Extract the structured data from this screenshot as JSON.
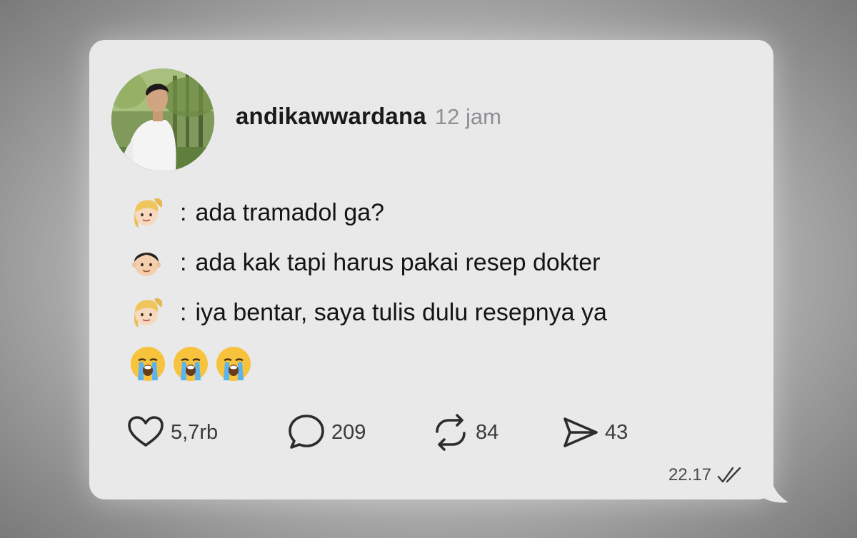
{
  "post": {
    "username": "andikawwardana",
    "time_ago": "12 jam",
    "avatar_icon": "profile-photo-man-white-shirt-garden"
  },
  "chat": [
    {
      "speaker_icon": "woman-blonde-ponytail-emoji",
      "separator": ":",
      "text": "ada tramadol ga?"
    },
    {
      "speaker_icon": "man-black-hair-emoji",
      "separator": ":",
      "text": "ada kak tapi harus pakai resep dokter"
    },
    {
      "speaker_icon": "woman-blonde-ponytail-emoji",
      "separator": ":",
      "text": "iya bentar, saya tulis dulu resepnya ya"
    }
  ],
  "reaction_emojis": [
    "loudly-crying-face-emoji",
    "loudly-crying-face-emoji",
    "loudly-crying-face-emoji"
  ],
  "actions": {
    "like": {
      "icon": "heart-icon",
      "count": "5,7rb"
    },
    "comment": {
      "icon": "speech-bubble-icon",
      "count": "209"
    },
    "repost": {
      "icon": "repost-icon",
      "count": "84"
    },
    "share": {
      "icon": "paper-plane-icon",
      "count": "43"
    }
  },
  "message_meta": {
    "timestamp": "22.17",
    "read_icon": "double-check-icon"
  },
  "colors": {
    "bubble": "#e9e9ea",
    "text": "#141414",
    "muted": "#8e8e93",
    "icon": "#2c2c2e"
  }
}
